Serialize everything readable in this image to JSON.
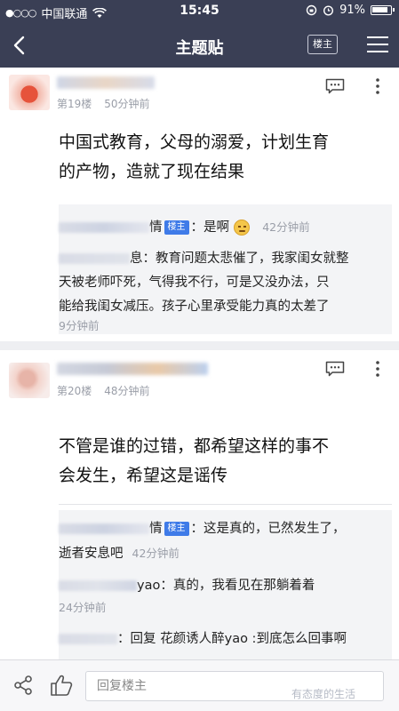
{
  "status_bar": {
    "signal_dots": "●○○○",
    "carrier": "中国联通",
    "wifi_icon": "wifi-icon",
    "time": "15:45",
    "battery_percent": "91%"
  },
  "nav": {
    "title": "主题贴",
    "back_icon": "chevron-left-icon",
    "louzhu_label": "楼主",
    "menu_icon": "hamburger-icon"
  },
  "posts": [
    {
      "floor": "第19楼",
      "time": "50分钟前",
      "body_lines": [
        "中国式教育，父母的溺爱，计划生育",
        "的产物，造就了现在结果"
      ],
      "replies": [
        {
          "name_suffix": "情",
          "badge": "楼主",
          "text": "：是啊",
          "time": "42分钟前"
        },
        {
          "name_suffix": "息",
          "lines": [
            "：教育问题太悲催了，我家闺女就整",
            "天被老师吓死，气得我不行，可是又没办法，只",
            "能给我闺女减压。孩子心里承受能力真的太差了"
          ],
          "time": "9分钟前"
        }
      ]
    },
    {
      "floor": "第20楼",
      "time": "48分钟前",
      "body_lines": [
        "不管是谁的过错，都希望这样的事不",
        "会发生，希望这是谣传"
      ],
      "replies": [
        {
          "name_suffix": "情",
          "badge": "楼主",
          "lines": [
            "：这是真的，已然发生了，",
            "逝者安息吧"
          ],
          "time": "42分钟前"
        },
        {
          "name_suffix": "yao",
          "text": "：真的，我看见在那躺着着",
          "time": "24分钟前"
        },
        {
          "text": "：回复 花颜诱人醉yao :到底怎么回事啊"
        }
      ]
    }
  ],
  "bottom_bar": {
    "share_icon": "share-icon",
    "like_icon": "thumbs-up-icon",
    "reply_placeholder": "回复楼主"
  },
  "watermark": "有态度的生活",
  "colors": {
    "header_bg": "#3a3f55",
    "badge_blue": "#3f7be8"
  }
}
